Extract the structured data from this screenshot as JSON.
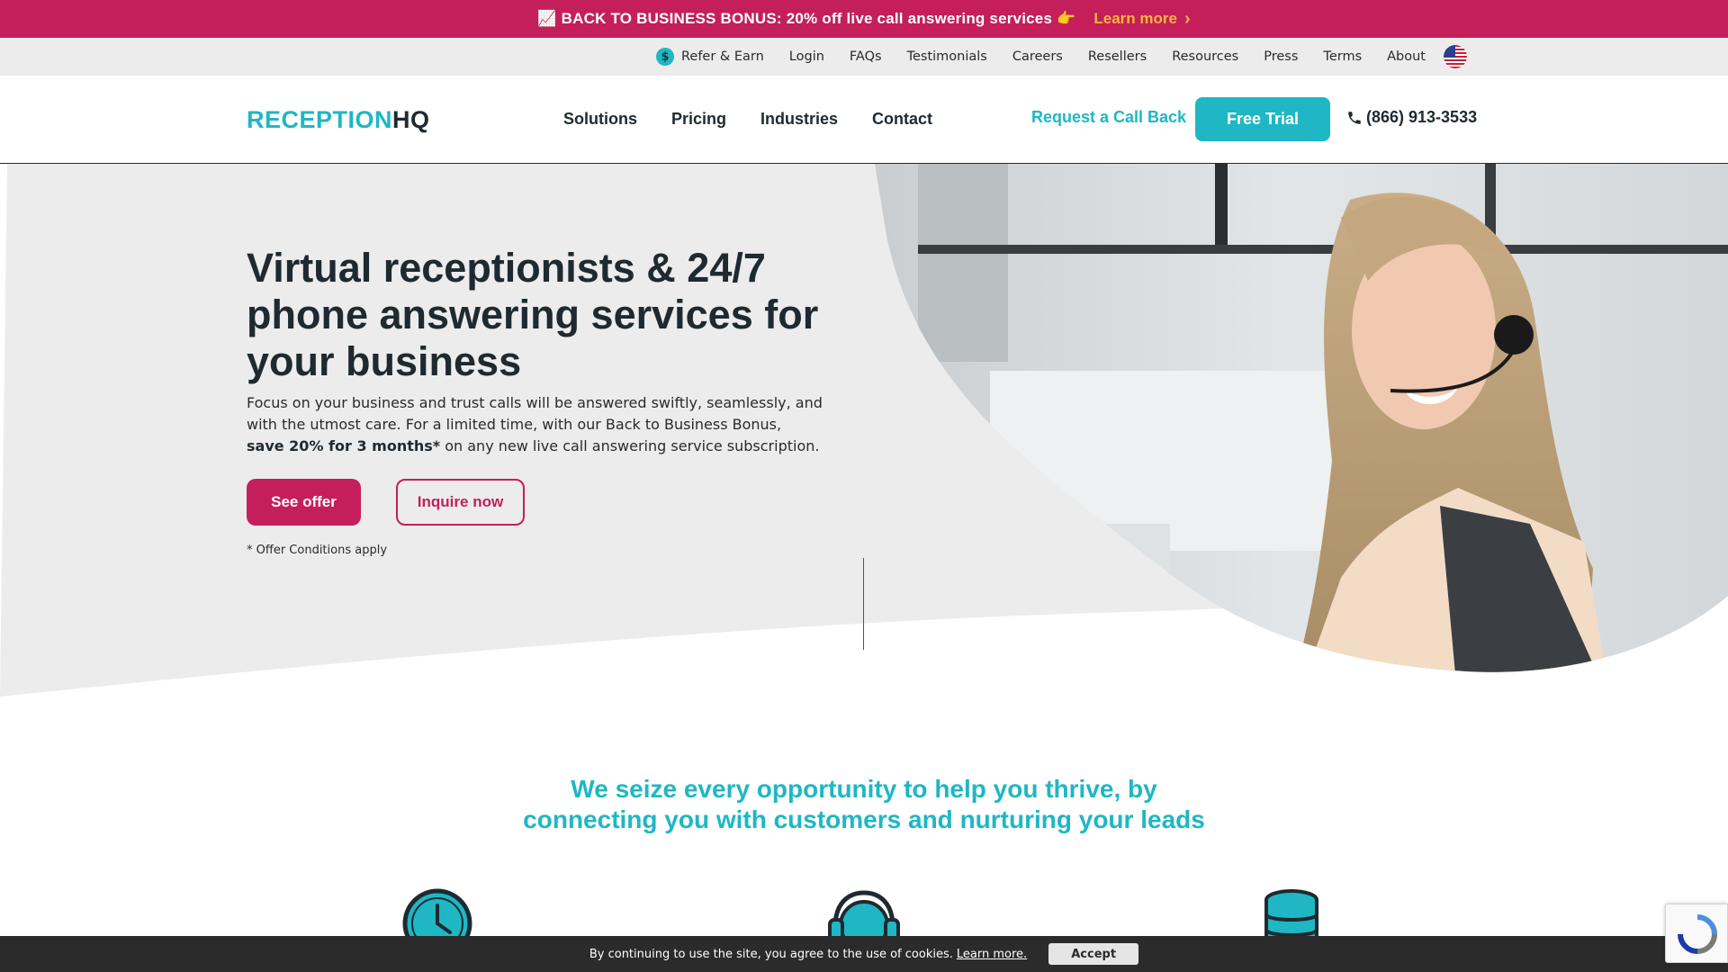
{
  "promo": {
    "text": "📈 BACK TO BUSINESS BONUS: 20% off live call answering services 👉",
    "link": "Learn more",
    "color": "#c41f5b",
    "link_color": "#ffb23f"
  },
  "utility_nav": {
    "items": [
      "Refer & Earn",
      "Login",
      "FAQs",
      "Testimonials",
      "Careers",
      "Resellers",
      "Resources",
      "Press",
      "Terms",
      "About"
    ],
    "flag": "us-flag-icon"
  },
  "header": {
    "logo_part1": "RECEPTION",
    "logo_part2": "HQ",
    "nav": [
      "Solutions",
      "Pricing",
      "Industries",
      "Contact"
    ],
    "callback": "Request a Call Back",
    "trial": "Free Trial",
    "phone": "(866) 913-3533",
    "accent": "#1fb7c4"
  },
  "hero": {
    "title": "Virtual receptionists & 24/7 phone answering services for your business",
    "desc_part1": "Focus on your business and trust calls will be answered swiftly, seamlessly, and with the utmost care. For a limited time, with our Back to Business Bonus, ",
    "desc_bold": "save 20% for 3 months*",
    "desc_part2": " on any new live call answering service subscription.",
    "btn_offer": "See offer",
    "btn_inquire": "Inquire now",
    "conditions": "* Offer Conditions apply"
  },
  "tagline": {
    "line1": "We seize every opportunity to help you thrive, by",
    "line2": "connecting you with customers and nurturing your leads"
  },
  "features": {
    "icons": [
      "clock-icon",
      "headset-icon",
      "database-icon"
    ]
  },
  "cookie": {
    "text": "By continuing to use the site, you agree to the use of cookies.",
    "link": "Learn more.",
    "accept": "Accept"
  }
}
